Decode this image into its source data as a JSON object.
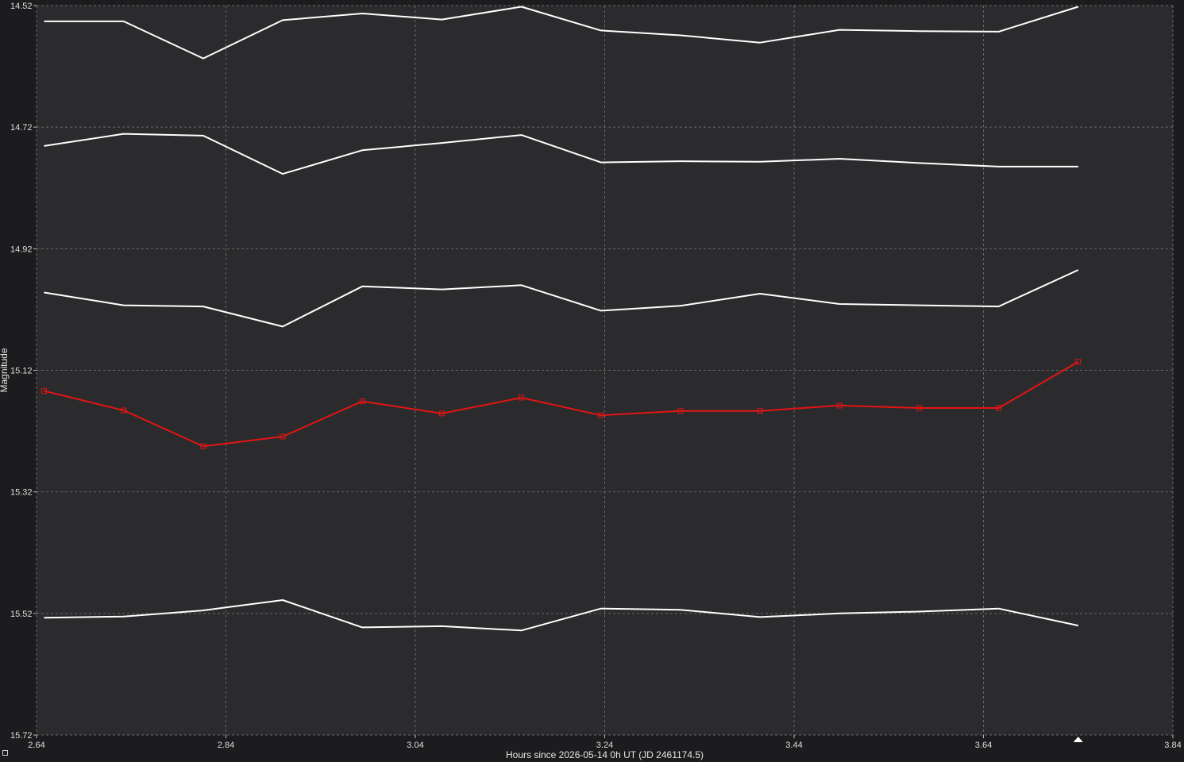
{
  "colors": {
    "background": "#1c1c1e",
    "plot_background": "#2b2b2d",
    "grid": "#6a6a6a",
    "comparison_line": "#ffffff",
    "target_line": "#e41414"
  },
  "icons": {
    "cursor_marker": "triangle-up-icon",
    "corner_toggle": "square-icon"
  },
  "chart_data": {
    "type": "line",
    "xlabel": "Hours since 2026-05-14 0h UT (JD 2461174.5)",
    "ylabel": "Magnitude",
    "xlim": [
      2.64,
      3.84
    ],
    "ylim": [
      15.72,
      14.52
    ],
    "y_inverted": true,
    "grid": true,
    "x_ticks": [
      "2.64",
      "2.84",
      "3.04",
      "3.24",
      "3.44",
      "3.64",
      "3.84"
    ],
    "y_ticks": [
      "14.52",
      "14.72",
      "14.92",
      "15.12",
      "15.32",
      "15.52",
      "15.72"
    ],
    "x": [
      2.648,
      2.732,
      2.816,
      2.9,
      2.984,
      3.068,
      3.152,
      3.236,
      3.32,
      3.404,
      3.488,
      3.572,
      3.656,
      3.74
    ],
    "series": [
      {
        "role": "comparison",
        "color": "#ffffff",
        "markers": false,
        "values": [
          14.546,
          14.546,
          14.607,
          14.544,
          14.533,
          14.543,
          14.522,
          14.561,
          14.569,
          14.581,
          14.56,
          14.562,
          14.563,
          14.522
        ]
      },
      {
        "role": "comparison",
        "color": "#ffffff",
        "markers": false,
        "values": [
          14.751,
          14.731,
          14.734,
          14.797,
          14.758,
          14.746,
          14.733,
          14.778,
          14.776,
          14.777,
          14.772,
          14.779,
          14.785,
          14.785
        ]
      },
      {
        "role": "comparison",
        "color": "#ffffff",
        "markers": false,
        "values": [
          14.992,
          15.013,
          15.015,
          15.048,
          14.982,
          14.987,
          14.98,
          15.022,
          15.014,
          14.994,
          15.011,
          15.013,
          15.015,
          14.955
        ]
      },
      {
        "role": "target",
        "color": "#e41414",
        "markers": true,
        "values": [
          15.154,
          15.186,
          15.245,
          15.229,
          15.171,
          15.191,
          15.165,
          15.194,
          15.187,
          15.187,
          15.178,
          15.182,
          15.182,
          15.106
        ]
      },
      {
        "role": "comparison",
        "color": "#ffffff",
        "markers": false,
        "values": [
          15.527,
          15.525,
          15.515,
          15.498,
          15.543,
          15.541,
          15.548,
          15.512,
          15.514,
          15.526,
          15.52,
          15.517,
          15.512,
          15.54
        ]
      }
    ],
    "cursor_marker_x": 3.74
  }
}
